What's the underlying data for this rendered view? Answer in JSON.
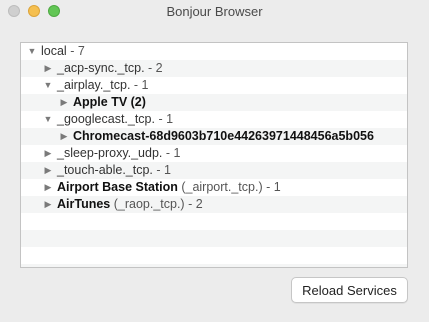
{
  "window": {
    "title": "Bonjour Browser"
  },
  "tree": [
    {
      "expanded": true,
      "label": "local",
      "suffix": " - 7",
      "bold": false
    },
    {
      "expanded": false,
      "label": "_acp-sync._tcp.",
      "suffix": " - 2",
      "bold": false
    },
    {
      "expanded": true,
      "label": "_airplay._tcp.",
      "suffix": " - 1",
      "bold": false
    },
    {
      "expanded": false,
      "label": "Apple TV (2)",
      "suffix": "",
      "bold": true
    },
    {
      "expanded": true,
      "label": "_googlecast._tcp.",
      "suffix": " - 1",
      "bold": false
    },
    {
      "expanded": false,
      "label": "Chromecast-68d9603b710e44263971448456a5b056",
      "suffix": "",
      "bold": true
    },
    {
      "expanded": false,
      "label": "_sleep-proxy._udp.",
      "suffix": " - 1",
      "bold": false
    },
    {
      "expanded": false,
      "label": "_touch-able._tcp.",
      "suffix": " - 1",
      "bold": false
    },
    {
      "expanded": false,
      "label": "Airport Base Station",
      "suffix": " (_airport._tcp.) - 1",
      "bold": true
    },
    {
      "expanded": false,
      "label": "AirTunes",
      "suffix": " (_raop._tcp.) - 2",
      "bold": true
    }
  ],
  "buttons": {
    "reload_label": "Reload Services"
  }
}
